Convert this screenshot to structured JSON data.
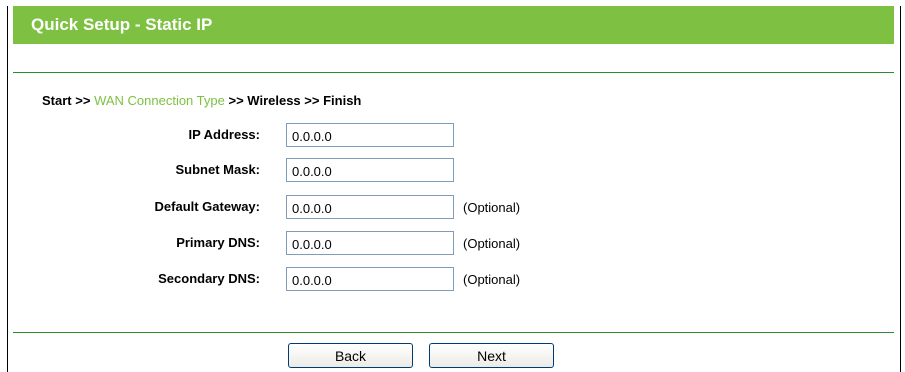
{
  "header": {
    "title": "Quick Setup - Static IP"
  },
  "breadcrumb": {
    "start": "Start",
    "sep1": ">>",
    "wan": "WAN Connection Type",
    "sep2": ">>",
    "wireless": "Wireless",
    "sep3": ">>",
    "finish": "Finish"
  },
  "form": {
    "fields": [
      {
        "label": "IP Address:",
        "value": "0.0.0.0",
        "note": ""
      },
      {
        "label": "Subnet Mask:",
        "value": "0.0.0.0",
        "note": ""
      },
      {
        "label": "Default Gateway:",
        "value": "0.0.0.0",
        "note": "(Optional)"
      },
      {
        "label": "Primary DNS:",
        "value": "0.0.0.0",
        "note": "(Optional)"
      },
      {
        "label": "Secondary DNS:",
        "value": "0.0.0.0",
        "note": "(Optional)"
      }
    ]
  },
  "buttons": {
    "back": "Back",
    "next": "Next"
  },
  "colors": {
    "title_bar": "#7ec142",
    "link": "#7ec142",
    "rule": "#2f8a2f"
  }
}
